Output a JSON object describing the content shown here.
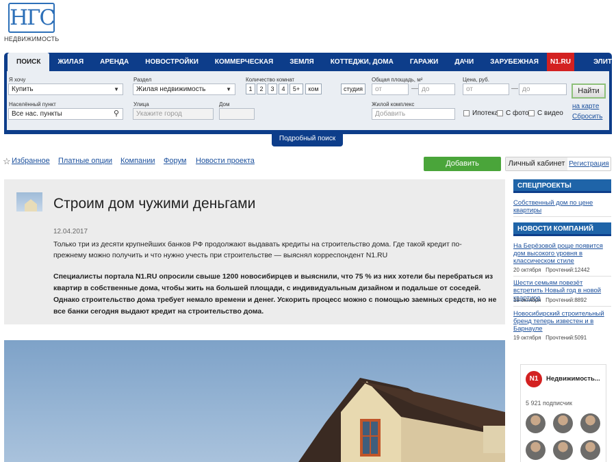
{
  "logo": {
    "mark": "НГС",
    "subtitle": "НЕДВИЖИМОСТЬ"
  },
  "tabs": [
    "ПОИСК",
    "ЖИЛАЯ",
    "АРЕНДА",
    "НОВОСТРОЙКИ",
    "КОММЕРЧЕСКАЯ",
    "ЗЕМЛЯ",
    "КОТТЕДЖИ, ДОМА",
    "ГАРАЖИ",
    "ДАЧИ",
    "ЗАРУБЕЖНАЯ",
    "N1.RU",
    "ЭЛИТНАЯ"
  ],
  "search": {
    "want_label": "Я хочу",
    "want_value": "Купить",
    "section_label": "Раздел",
    "section_value": "Жилая недвижимость",
    "rooms_label": "Количество комнат",
    "rooms": [
      "1",
      "2",
      "3",
      "4",
      "5+",
      "ком"
    ],
    "studio": "студия",
    "area_label": "Общая площадь, м²",
    "area_from": "от",
    "area_to": "до",
    "price_label": "Цена, руб.",
    "price_from": "от",
    "price_to": "до",
    "find_button": "Найти",
    "city_label": "Населённый пункт",
    "city_value": "Все нас. пункты",
    "street_label": "Улица",
    "street_placeholder": "Укажите город",
    "house_label": "Дом",
    "complex_label": "Жилой комплекс",
    "complex_placeholder": "Добавить",
    "mortgage": "Ипотека",
    "with_photo": "С фото",
    "with_video": "С видео",
    "map_link": "на карте",
    "reset_link": "Сбросить",
    "detail_button": "Подробный поиск"
  },
  "links": [
    "Избранное",
    "Платные опции",
    "Компании",
    "Форум",
    "Новости проекта"
  ],
  "add_ad": "Добавить объявление",
  "cabinet": "Личный кабинет",
  "registration": "Регистрация",
  "article": {
    "title": "Строим дом чужими деньгами",
    "date": "12.04.2017",
    "lead": "Только три из десяти крупнейших банков РФ продолжают выдавать кредиты на строительство дома. Где такой кредит по-прежнему можно получить и что нужно учесть при строительстве — выяснял корреспондент N1.RU",
    "body": "Специалисты портала N1.RU опросили свыше 1200 новосибирцев и выяснили, что 75 % из них хотели бы перебраться из квартир в собственные дома, чтобы жить на большей площади, с индивидуальным дизайном и подальше от соседей. Однако строительство дома требует немало времени и денег. Ускорить процесс можно с помощью заемных средств, но не все банки сегодня выдают кредит на строительство дома."
  },
  "sidebar": {
    "special_title": "СПЕЦПРОЕКТЫ",
    "special_link": "Собственный дом по цене квартиры",
    "news_title": "НОВОСТИ КОМПАНИЙ",
    "news": [
      {
        "title": "На Берёзовой роще появится дом высокого уровня в классическом стиле",
        "date": "20 октября",
        "views": "Прочтений:12442"
      },
      {
        "title": "Шести семьям повезёт встретить Новый год в новой квартире",
        "date": "19 октября",
        "views": "Прочтений:8892"
      },
      {
        "title": "Новосибирский строительный бренд теперь известен и в Барнауле",
        "date": "19 октября",
        "views": "Прочтений:5091"
      }
    ],
    "widget": {
      "logo": "N1",
      "name": "Недвижимость...",
      "subscribers": "5 921 подписчик"
    }
  }
}
